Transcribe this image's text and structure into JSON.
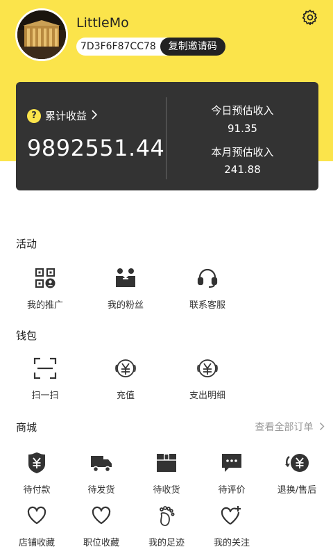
{
  "profile": {
    "username": "LittleMo",
    "invite_code": "7D3F6F87CC78",
    "copy_invite_label": "复制邀请码"
  },
  "earnings": {
    "accumulated_label": "累计收益",
    "accumulated_value": "9892551.44",
    "today_label": "今日预估收入",
    "today_value": "91.35",
    "month_label": "本月预估收入",
    "month_value": "241.88"
  },
  "activity": {
    "title": "活动",
    "items": [
      {
        "label": "我的推广",
        "icon": "qr-person-icon"
      },
      {
        "label": "我的粉丝",
        "icon": "fans-icon"
      },
      {
        "label": "联系客服",
        "icon": "headset-icon"
      }
    ]
  },
  "wallet": {
    "title": "钱包",
    "items": [
      {
        "label": "扫一扫",
        "icon": "scan-icon"
      },
      {
        "label": "充值",
        "icon": "yuan-coin-icon"
      },
      {
        "label": "支出明细",
        "icon": "yuan-coin-icon"
      }
    ]
  },
  "mall": {
    "title": "商城",
    "view_all": "查看全部订单",
    "orders": [
      {
        "label": "待付款",
        "icon": "wallet-yuan-icon"
      },
      {
        "label": "待发货",
        "icon": "truck-icon"
      },
      {
        "label": "待收货",
        "icon": "box-icon"
      },
      {
        "label": "待评价",
        "icon": "comment-icon"
      },
      {
        "label": "退换/售后",
        "icon": "refund-icon"
      }
    ],
    "favorites": [
      {
        "label": "店铺收藏",
        "icon": "heart-icon"
      },
      {
        "label": "职位收藏",
        "icon": "heart-icon"
      },
      {
        "label": "我的足迹",
        "icon": "footprint-icon"
      },
      {
        "label": "我的关注",
        "icon": "heart-plus-icon"
      }
    ]
  },
  "colors": {
    "header_yellow": "#fbe44b",
    "card_dark": "#333333"
  }
}
